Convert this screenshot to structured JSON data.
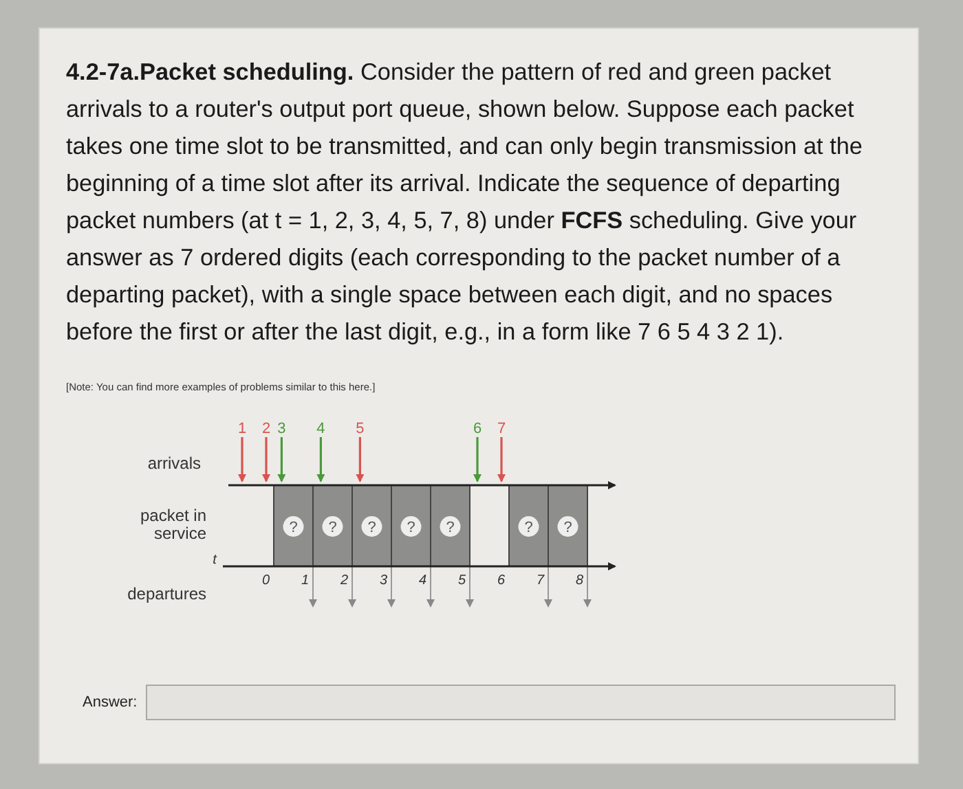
{
  "question": "**4.2-7a.Packet scheduling.** Consider the pattern of red and green packet arrivals to a router's output port queue, shown below. Suppose each packet takes one time slot to be transmitted, and can only begin transmission at the beginning of a time slot after its arrival.  Indicate the sequence of departing packet numbers (at t = 1, 2, 3, 4, 5, 7, 8) under **FCFS** scheduling. Give your answer as 7 ordered digits (each corresponding to the packet number of a departing packet), with a single space between each digit, and no spaces before the first or after the last digit, e.g., in a form like 7 6 5 4 3 2 1).",
  "note": "[Note: You can find more examples of problems similar to this here.]",
  "diagram": {
    "row_labels": {
      "arrivals": "arrivals",
      "service": "packet in service",
      "departures": "departures"
    },
    "time_label": "t",
    "intervals": [
      {
        "arrivals": [
          {
            "label": "1",
            "color": "#d9534f"
          },
          {
            "label": "2",
            "color": "#d9534f"
          }
        ]
      },
      {
        "arrivals": [
          {
            "label": "3",
            "color": "#4a9a3a"
          }
        ],
        "service": {
          "label": "?"
        }
      },
      {
        "arrivals": [
          {
            "label": "4",
            "color": "#4a9a3a"
          }
        ],
        "service": {
          "label": "?"
        }
      },
      {
        "arrivals": [
          {
            "label": "5",
            "color": "#d9534f"
          }
        ],
        "service": {
          "label": "?"
        }
      },
      {
        "service": {
          "label": "?"
        }
      },
      {
        "service": {
          "label": "?"
        }
      },
      {
        "arrivals": [
          {
            "label": "6",
            "color": "#4a9a3a"
          },
          {
            "label": "7",
            "color": "#d9534f"
          }
        ]
      },
      {
        "service": {
          "label": "?"
        }
      },
      {
        "service": {
          "label": "?"
        }
      }
    ],
    "ticks": [
      "0",
      "1",
      "2",
      "3",
      "4",
      "5",
      "6",
      "7",
      "8"
    ]
  },
  "answer": {
    "label": "Answer:"
  }
}
